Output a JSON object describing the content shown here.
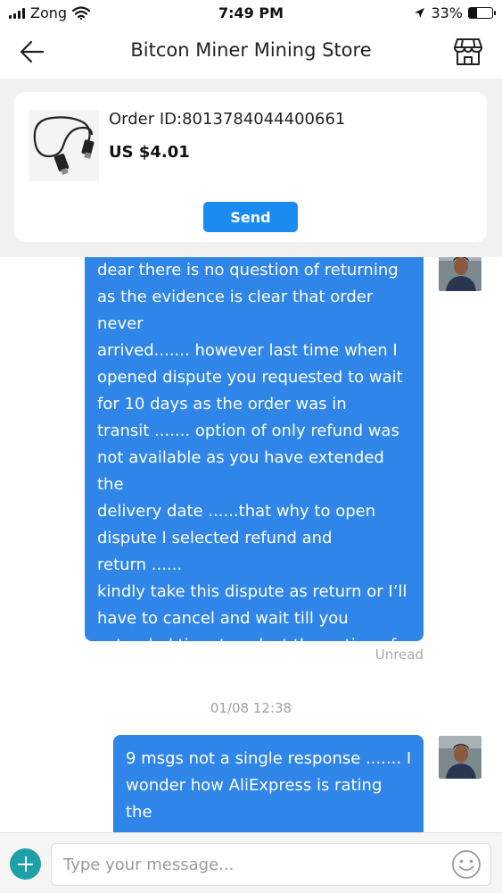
{
  "status_bar": {
    "carrier": "Zong",
    "time": "7:49 PM",
    "battery_percent": "33%",
    "battery_level": 0.33,
    "icons": [
      "signal-icon",
      "wifi-icon",
      "location-arrow-icon",
      "battery-icon"
    ]
  },
  "header": {
    "title": "Bitcon Miner Mining Store",
    "back_icon": "arrow-left-icon",
    "store_icon": "storefront-icon"
  },
  "order": {
    "id_text": "Order ID:8013784044400661",
    "price": "US $4.01",
    "send_label": "Send"
  },
  "messages": [
    {
      "text": "dear there is no question of returning\nas the evidence is clear that order never\narrived....... however last time when I\nopened dispute you requested to wait\nfor 10 days as the order was in\ntransit .......  option of only refund was\nnot available as you have extended the\ndelivery date ......that why to open\ndispute I selected refund and\nreturn ......\nkindly take this dispute as return or I’ll\nhave to cancel and wait till you\nextended time to select the option of\nsimple return .......",
      "status": "Unread"
    },
    {
      "timestamp": "01/08 12:38",
      "text": "9 msgs not a single response ....... I\nwonder how AliExpress is rating the\nstores ?????"
    }
  ],
  "input": {
    "placeholder": "Type your message...",
    "value": ""
  },
  "colors": {
    "bubble": "#2f86e8",
    "send_button": "#1a8cf0",
    "plus_button": "#1fa0a8"
  }
}
